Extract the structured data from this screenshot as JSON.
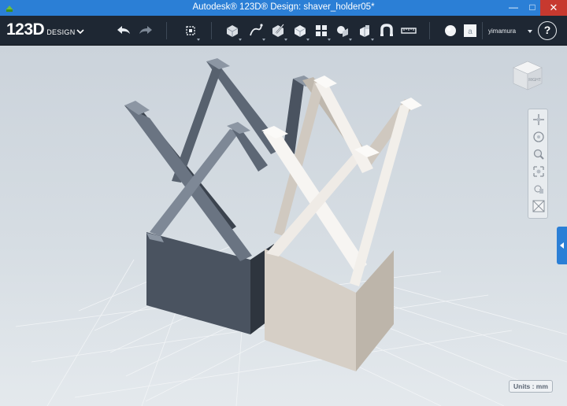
{
  "window": {
    "title": "Autodesk® 123D® Design: shaver_holder05*",
    "minimize_glyph": "—",
    "maximize_glyph": "□",
    "close_glyph": "✕"
  },
  "toolbar": {
    "logo_main": "123D",
    "logo_sub": "DESIGN",
    "tools": [
      "undo-icon",
      "redo-icon",
      "transform-icon",
      "primitives-icon",
      "sketch-icon",
      "construct-icon",
      "modify-icon",
      "pattern-icon",
      "group-icon",
      "combine-icon",
      "snap-icon",
      "measure-icon",
      "material-icon",
      "text-icon"
    ],
    "user_name": "yimamura",
    "help_glyph": "?"
  },
  "viewcube": {
    "face_label": "RIGHT"
  },
  "units_label": "Units : mm",
  "colors": {
    "accent": "#2b7fd6",
    "toolbar_bg": "#1e2733",
    "model_dark": "#3d4651",
    "model_light": "#d8d2ca"
  }
}
